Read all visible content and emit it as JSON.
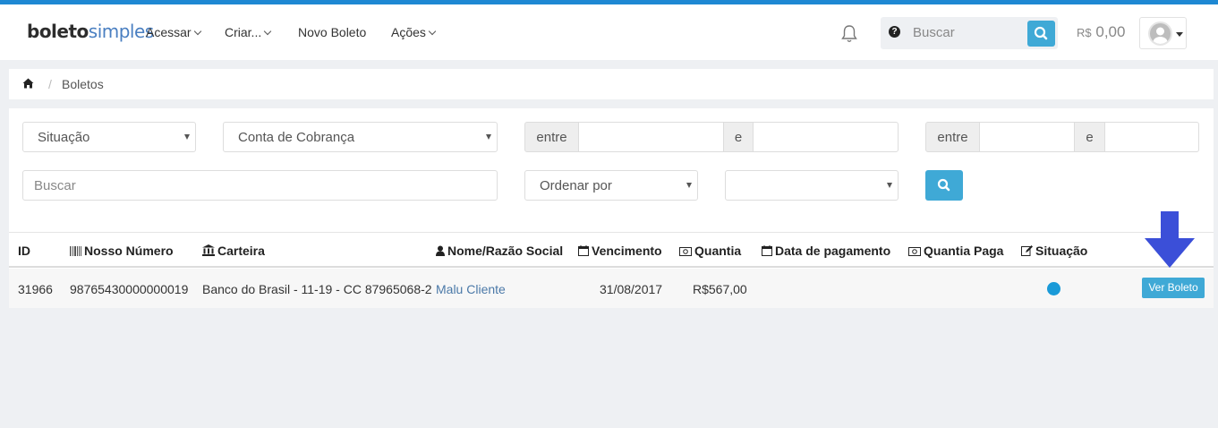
{
  "brand": {
    "part1": "boleto",
    "part2": "simples"
  },
  "nav": [
    {
      "label": "Acessar",
      "has_dropdown": true
    },
    {
      "label": "Criar...",
      "has_dropdown": true
    },
    {
      "label": "Novo Boleto",
      "has_dropdown": false
    },
    {
      "label": "Ações",
      "has_dropdown": true
    }
  ],
  "header": {
    "search_placeholder": "Buscar",
    "balance_currency": "R$",
    "balance_value": "0,00"
  },
  "breadcrumb": {
    "current": "Boletos",
    "separator": "/"
  },
  "filters": {
    "situacao": "Situação",
    "conta": "Conta de Cobrança",
    "range1_prefix": "entre",
    "range1_mid": "e",
    "range2_prefix": "entre",
    "range2_mid": "e",
    "search_placeholder": "Buscar",
    "ordenar": "Ordenar por",
    "ordem": ""
  },
  "table": {
    "columns": [
      "ID",
      "Nosso Número",
      "Carteira",
      "Nome/Razão Social",
      "Vencimento",
      "Quantia",
      "Data de pagamento",
      "Quantia Paga",
      "Situação"
    ],
    "rows": [
      {
        "id": "31966",
        "nosso_numero": "98765430000000019",
        "carteira": "Banco do Brasil - 11-19 - CC 87965068-2",
        "nome": "Malu Cliente",
        "vencimento": "31/08/2017",
        "quantia": "R$567,00",
        "data_pagamento": "",
        "quantia_paga": "",
        "action_label": "Ver Boleto"
      }
    ]
  },
  "colors": {
    "accent": "#3fa9d6",
    "topline": "#1e88d3",
    "status_dot": "#1a9ad8",
    "annotation_arrow": "#3b4fd8"
  }
}
